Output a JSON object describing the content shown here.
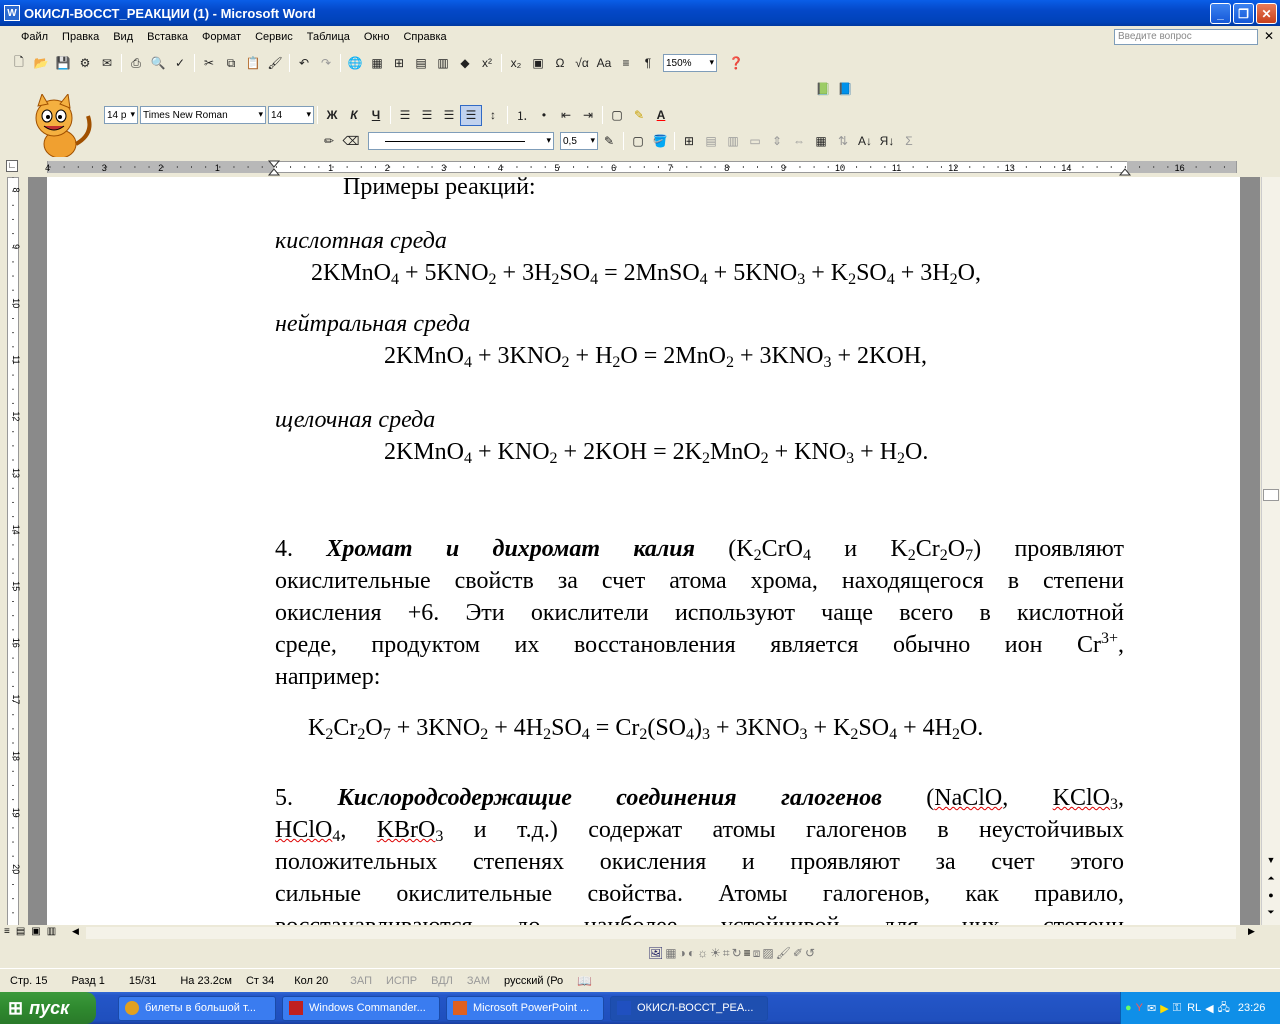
{
  "window": {
    "title": "ОКИСЛ-ВОССТ_РЕАКЦИИ (1) - Microsoft Word",
    "app_icon": "W"
  },
  "menu": [
    "Файл",
    "Правка",
    "Вид",
    "Вставка",
    "Формат",
    "Сервис",
    "Таблица",
    "Окно",
    "Справка"
  ],
  "help_box": {
    "placeholder": "Введите вопрос"
  },
  "toolbar": {
    "zoom": "150%",
    "style": "14 р",
    "font": "Times New Roman",
    "size": "14",
    "line_width": "0,5"
  },
  "ruler": {
    "h_labels": [
      "4",
      "3",
      "2",
      "1",
      "1",
      "2",
      "3",
      "4",
      "5",
      "6",
      "7",
      "8",
      "9",
      "10",
      "11",
      "12",
      "13",
      "14",
      "16"
    ],
    "v_labels": [
      "8",
      "9",
      "10",
      "11",
      "12",
      "13",
      "14",
      "15",
      "16",
      "17",
      "18",
      "19",
      "20"
    ]
  },
  "document": {
    "heading": "Примеры реакций:",
    "acid_label": "кислотная среда",
    "acid_eq": "2KMnO<sub>4</sub> + 5KNO<sub>2</sub> + 3H<sub>2</sub>SO<sub>4</sub> = 2MnSO<sub>4</sub> + 5KNO<sub>3</sub> + K<sub>2</sub>SO<sub>4</sub> + 3H<sub>2</sub>O,",
    "neutral_label": "нейтральная среда",
    "neutral_eq": "2KMnO<sub>4</sub> + 3KNO<sub>2</sub> + H<sub>2</sub>O = 2MnO<sub>2</sub> + 3KNO<sub>3</sub> + 2KOH,",
    "alkaline_label": "щелочная среда",
    "alkaline_eq": "2KMnO<sub>4</sub> + KNO<sub>2</sub> + 2KOH = 2K<sub>2</sub>MnO<sub>2</sub> + KNO<sub>3</sub> + H<sub>2</sub>O.",
    "p4_lines": [
      "4. <span class=\"bi\">Хромат и дихромат калия</span> (K<sub>2</sub>CrO<sub>4</sub> и K<sub>2</sub>Cr<sub>2</sub>O<sub>7</sub>) проявляют",
      "окислительные свойств за счет атома хрома, находящегося в степени",
      "окисления +6. Эти окислители используют чаще всего в кислотной",
      "среде, продуктом их восстановления является обычно ион Cr<sup>3+</sup>,",
      "например:"
    ],
    "dichromate_eq": "K<sub>2</sub>Cr<sub>2</sub>O<sub>7</sub> + 3KNO<sub>2</sub> + 4H<sub>2</sub>SO<sub>4</sub> = Cr<sub>2</sub>(SO<sub>4</sub>)<sub>3</sub> + 3KNO<sub>3</sub> + K<sub>2</sub>SO<sub>4</sub> + 4H<sub>2</sub>O.",
    "p5_lines": [
      "5. <span class=\"bi\">Кислородсодержащие соединения галогенов</span> (<span class=\"sq\">NaClO</span>, <span class=\"sq\">KClO<sub>3</sub></span>,",
      "<span class=\"sq\">HClO<sub>4</sub></span>, <span class=\"sq\">KBrO<sub>3</sub></span> и т.д.) содержат атомы галогенов в неустойчивых",
      "положительных степенях окисления и проявляют за счет этого",
      "сильные окислительные свойства. Атомы галогенов, как правило,",
      "восстанавливаются до наиболее устойчивой для них степени"
    ]
  },
  "status": {
    "page": "Стр. 15",
    "section": "Разд 1",
    "pages": "15/31",
    "at": "На 23.2см",
    "line": "Ст 34",
    "col": "Кол 20",
    "rec": "ЗАП",
    "trk": "ИСПР",
    "ext": "ВДЛ",
    "ovr": "ЗАМ",
    "lang": "русский (Ро"
  },
  "taskbar": {
    "start": "пуск",
    "tasks": [
      "билеты в большой т...",
      "Windows Commander...",
      "Microsoft PowerPoint ...",
      "ОКИСЛ-ВОССТ_РЕА..."
    ],
    "lang": "RL",
    "time": "23:26"
  }
}
